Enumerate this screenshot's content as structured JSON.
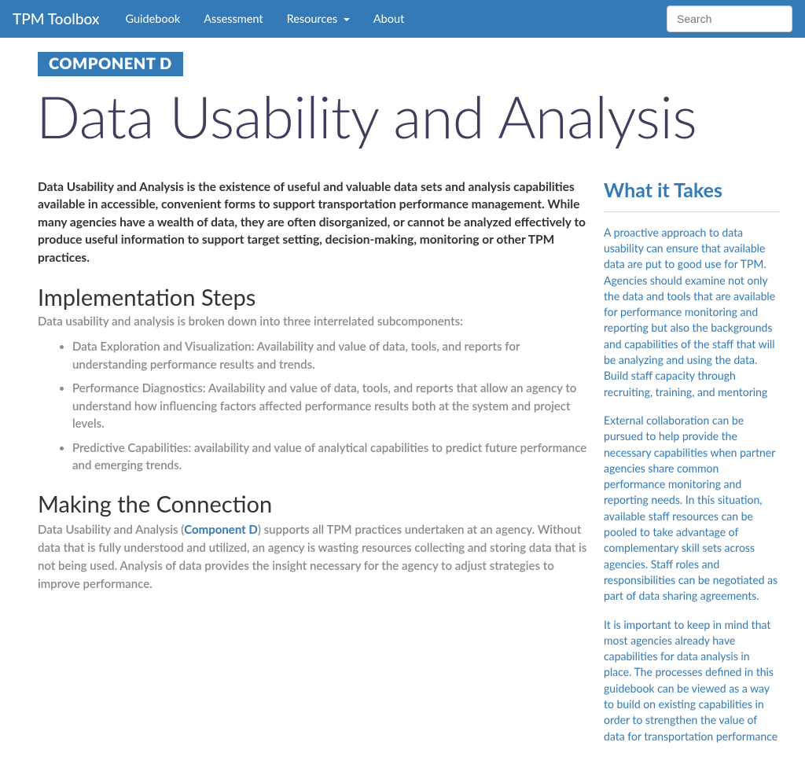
{
  "nav": {
    "brand": "TPM Toolbox",
    "links": [
      "Guidebook",
      "Assessment",
      "Resources",
      "About"
    ],
    "search_placeholder": "Search"
  },
  "header": {
    "component_badge": "COMPONENT D",
    "title": "Data Usability and Analysis"
  },
  "main": {
    "intro": "Data Usability and Analysis is the existence of useful and valuable data sets and analysis capabilities available in accessible, convenient forms to support transportation performance management. While many agencies have a wealth of data, they are often disorganized, or cannot be analyzed effectively to produce useful information to support target setting, decision-making, monitoring or other TPM practices.",
    "sections": {
      "implementation": {
        "heading": "Implementation Steps",
        "subhead": "Data usability and analysis is broken down into three interrelated subcomponents:",
        "bullets": [
          "Data Exploration and Visualization: Availability and value of data, tools, and reports for understanding performance results and trends.",
          "Performance Diagnostics: Availability and value of data, tools, and reports that allow an agency to understand how influencing factors affected performance results both at the system and project levels.",
          "Predictive Capabilities: availability and value of analytical capabilities to predict future performance and emerging trends."
        ]
      },
      "connection": {
        "heading": "Making the Connection",
        "para_prefix": "Data Usability and Analysis (",
        "para_link": "Component D",
        "para_suffix": ") supports all TPM practices undertaken at an agency. Without data that is fully understood and utilized, an agency is wasting resources collecting and storing data that is not being used. Analysis of data provides the insight necessary for the agency to adjust strategies to improve performance."
      }
    }
  },
  "sidebar": {
    "title": "What it Takes",
    "paras": [
      "A proactive approach to data usability can ensure that available data are put to good use for TPM. Agencies should examine not only the data and tools that are available for performance monitoring and reporting but also the backgrounds and capabilities of the staff that will be analyzing and using the data. Build staff capacity through recruiting, training, and mentoring",
      "External collaboration can be pursued to help provide the necessary capabilities when partner agencies share common performance monitoring and reporting needs. In this situation, available staff resources can be pooled to take advantage of complementary skill sets across agencies. Staff roles and responsibilities can be negotiated as part of data sharing agreements.",
      "It is important to keep in mind that most agencies already have capabilities for data analysis in place. The processes defined in this guidebook can be viewed as a way to build on existing capabilities in order to strengthen the value of data for transportation performance"
    ]
  }
}
